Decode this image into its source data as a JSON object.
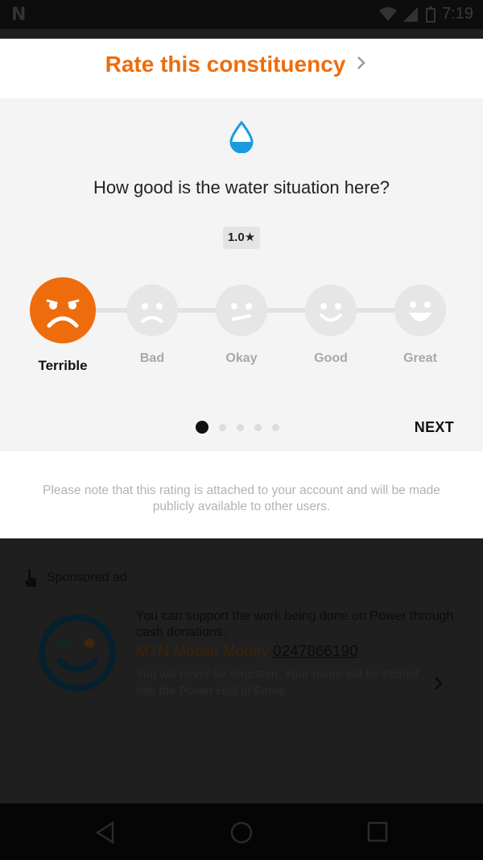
{
  "status_bar": {
    "time": "7:19"
  },
  "header": {
    "title": "Rate this constituency"
  },
  "rating": {
    "question": "How good is the water situation here?",
    "score": "1.0★",
    "options": [
      {
        "label": "Terrible",
        "selected": true
      },
      {
        "label": "Bad",
        "selected": false
      },
      {
        "label": "Okay",
        "selected": false
      },
      {
        "label": "Good",
        "selected": false
      },
      {
        "label": "Great",
        "selected": false
      }
    ],
    "pager": {
      "total": 5,
      "current": 1
    },
    "next_label": "NEXT"
  },
  "note": "Please note that this rating is attached to your account and will be made publicly available to other users.",
  "ad": {
    "sponsor_label": "Sponsored ad",
    "text": "You can support the work being done on Power through cash donations.",
    "provider": "MTN Mobile Money",
    "number": "0247866190",
    "subtext": "You will never be forgotten. Your name will be etched into the Power Hall of Fame"
  },
  "colors": {
    "accent": "#ef6c0c",
    "water": "#1a9be0"
  }
}
